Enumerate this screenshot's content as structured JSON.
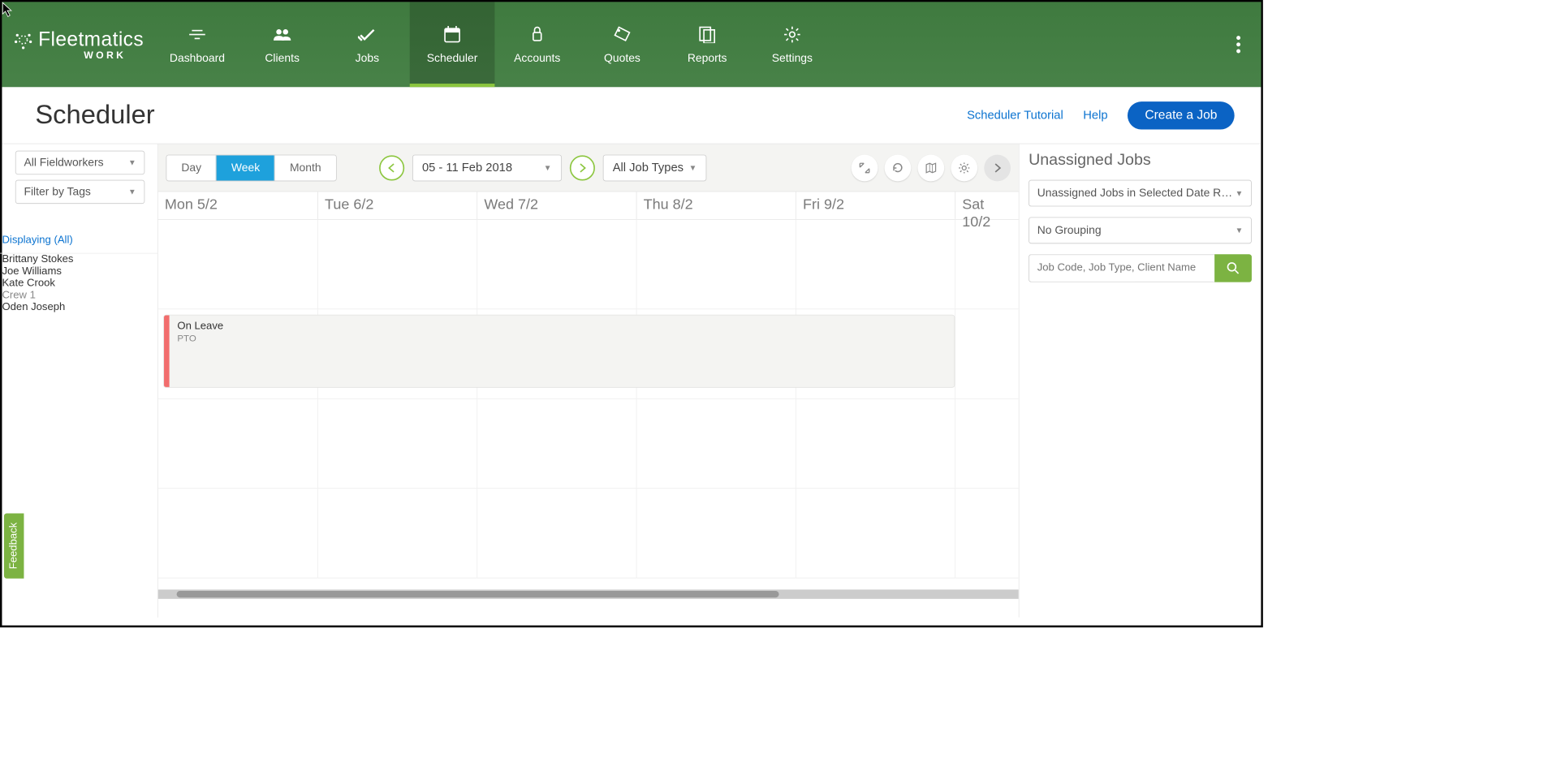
{
  "brand": {
    "name": "Fleetmatics",
    "sub": "WORK"
  },
  "nav": {
    "items": [
      {
        "label": "Dashboard"
      },
      {
        "label": "Clients"
      },
      {
        "label": "Jobs"
      },
      {
        "label": "Scheduler"
      },
      {
        "label": "Accounts"
      },
      {
        "label": "Quotes"
      },
      {
        "label": "Reports"
      },
      {
        "label": "Settings"
      }
    ],
    "activeIndex": 3
  },
  "page": {
    "title": "Scheduler",
    "tutorialLink": "Scheduler Tutorial",
    "helpLink": "Help",
    "createBtn": "Create a Job"
  },
  "filters": {
    "fieldworkers": "All Fieldworkers",
    "tags": "Filter by Tags",
    "displaying": "Displaying (All)"
  },
  "viewSeg": {
    "day": "Day",
    "week": "Week",
    "month": "Month",
    "active": "week"
  },
  "dateRange": "05 - 11 Feb 2018",
  "jobTypes": "All Job Types",
  "days": [
    "Mon 5/2",
    "Tue 6/2",
    "Wed 7/2",
    "Thu 8/2",
    "Fri 9/2",
    "Sat 10/2"
  ],
  "workers": [
    {
      "name": "Brittany Stokes",
      "sub": ""
    },
    {
      "name": "Joe Williams",
      "sub": ""
    },
    {
      "name": "Kate Crook",
      "sub": "Crew 1"
    },
    {
      "name": "Oden Joseph",
      "sub": ""
    }
  ],
  "event": {
    "title": "On Leave",
    "sub": "PTO",
    "rowIndex": 1,
    "startCol": 0,
    "spanCols": 5
  },
  "rightPanel": {
    "title": "Unassigned Jobs",
    "rangeDD": "Unassigned Jobs in Selected Date Ra...",
    "groupDD": "No Grouping",
    "searchPlaceholder": "Job Code, Job Type, Client Name"
  },
  "feedbackLabel": "Feedback"
}
